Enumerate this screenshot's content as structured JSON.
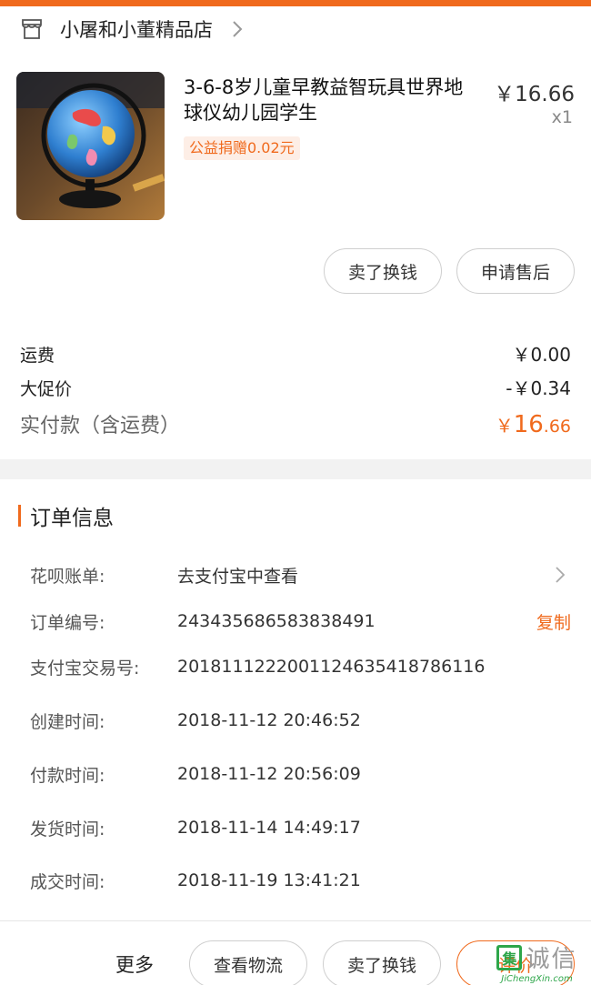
{
  "shop": {
    "name": "小屠和小董精品店"
  },
  "product": {
    "title": "3-6-8岁儿童早教益智玩具世界地球仪幼儿园学生",
    "price": "￥16.66",
    "qty": "x1",
    "charity": "公益捐赠0.02元",
    "buttons": {
      "sell": "卖了换钱",
      "after_sale": "申请售后"
    }
  },
  "costs": {
    "shipping_label": "运费",
    "shipping_value": "￥0.00",
    "promo_label": "大促价",
    "promo_value": "-￥0.34",
    "total_label": "实付款（含运费）",
    "total_currency": "￥",
    "total_int": "16",
    "total_dec": ".66"
  },
  "order_info": {
    "title": "订单信息",
    "rows": [
      {
        "label": "花呗账单:",
        "value": "去支付宝中查看"
      },
      {
        "label": "订单编号:",
        "value": "243435686583838491",
        "action": "复制"
      },
      {
        "label": "支付宝交易号:",
        "value": "2018111222001124635418786116"
      },
      {
        "label": "创建时间:",
        "value": "2018-11-12 20:46:52"
      },
      {
        "label": "付款时间:",
        "value": "2018-11-12 20:56:09"
      },
      {
        "label": "发货时间:",
        "value": "2018-11-14 14:49:17"
      },
      {
        "label": "成交时间:",
        "value": "2018-11-19 13:41:21"
      }
    ]
  },
  "bottom": {
    "more": "更多",
    "logistics": "查看物流",
    "sell": "卖了换钱",
    "review": "评价"
  },
  "watermark": {
    "box": "集",
    "text": "诚信",
    "url": "JiChengXin.com"
  },
  "colors": {
    "accent": "#f06a1d",
    "watermark_green": "#2ea64a"
  },
  "icons": {
    "shop": "shop-icon",
    "chevron": "chevron-right-icon"
  }
}
